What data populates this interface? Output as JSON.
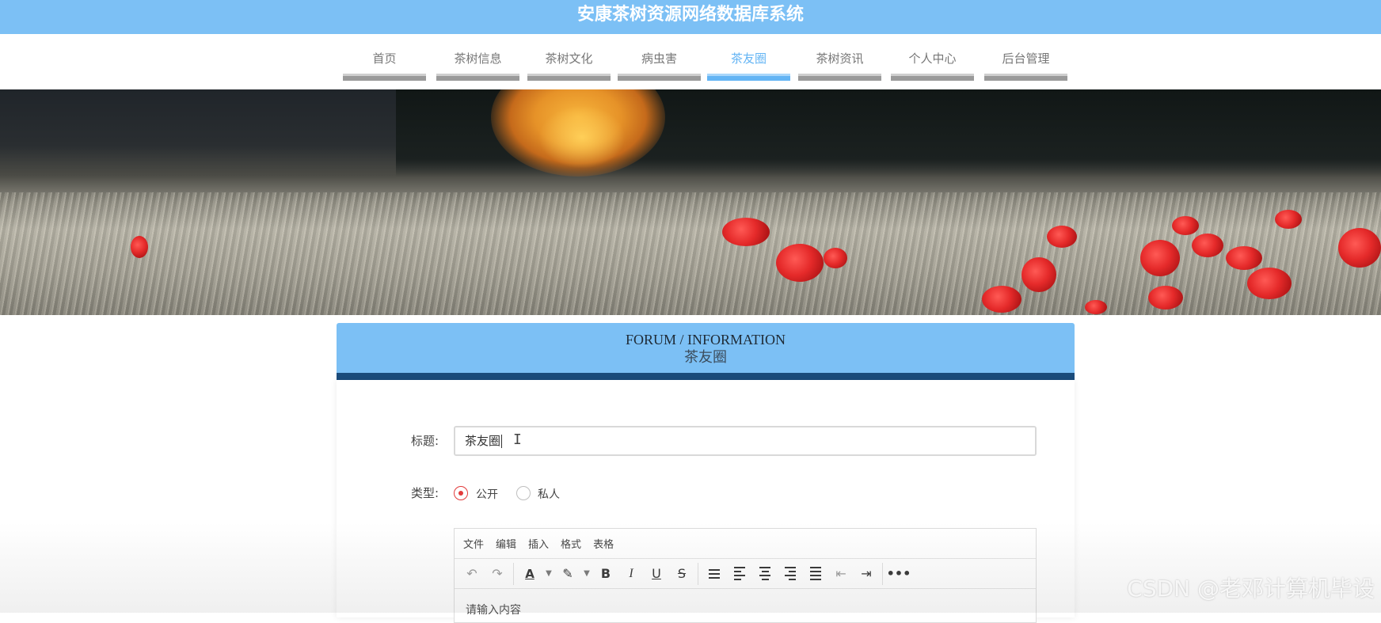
{
  "header": {
    "title": "安康茶树资源网络数据库系统"
  },
  "nav": {
    "items": [
      {
        "label": "首页"
      },
      {
        "label": "茶树信息"
      },
      {
        "label": "茶树文化"
      },
      {
        "label": "病虫害"
      },
      {
        "label": "茶友圈"
      },
      {
        "label": "茶树资讯"
      },
      {
        "label": "个人中心"
      },
      {
        "label": "后台管理"
      }
    ],
    "active": "茶友圈"
  },
  "section": {
    "title_en": "FORUM / INFORMATION",
    "title_cn": "茶友圈"
  },
  "form": {
    "title_label": "标题:",
    "title_value": "茶友圈",
    "type_label": "类型:",
    "type_options": [
      "公开",
      "私人"
    ],
    "type_selected": "公开"
  },
  "editor": {
    "menu": [
      "文件",
      "编辑",
      "插入",
      "格式",
      "表格"
    ],
    "placeholder": "请输入内容"
  },
  "watermark": "CSDN @老邓计算机毕设",
  "colors": {
    "accent": "#7cc0f5",
    "dark_bar": "#1b4c7c",
    "radio_active": "#e23b3b"
  }
}
